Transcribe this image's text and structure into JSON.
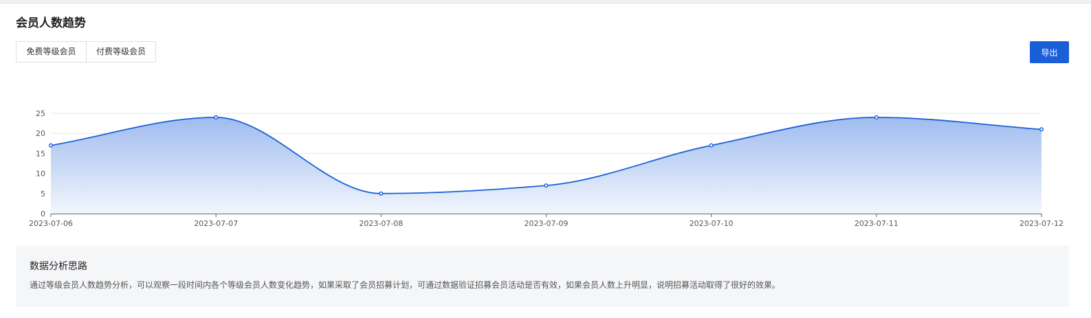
{
  "page": {
    "title": "会员人数趋势"
  },
  "tabs": [
    {
      "label": "免费等级会员",
      "active": true
    },
    {
      "label": "付费等级会员",
      "active": false
    }
  ],
  "toolbar": {
    "export_label": "导出"
  },
  "colors": {
    "accent": "#1a5fd8",
    "line": "#1a5fd8",
    "area_top": "#9fbcef",
    "area_bottom": "#f2f6fd"
  },
  "chart_data": {
    "type": "area",
    "x": [
      "2023-07-06",
      "2023-07-07",
      "2023-07-08",
      "2023-07-09",
      "2023-07-10",
      "2023-07-11",
      "2023-07-12"
    ],
    "series": [
      {
        "values": [
          17,
          24,
          5,
          7,
          17,
          24,
          21
        ]
      }
    ],
    "ylim": [
      0,
      25
    ],
    "yticks": [
      0,
      5,
      10,
      15,
      20,
      25
    ],
    "grid": true,
    "smooth": true
  },
  "analysis": {
    "title": "数据分析思路",
    "text": "通过等级会员人数趋势分析，可以观察一段时间内各个等级会员人数变化趋势，如果采取了会员招募计划，可通过数据验证招募会员活动是否有效，如果会员人数上升明显，说明招募活动取得了很好的效果。"
  }
}
